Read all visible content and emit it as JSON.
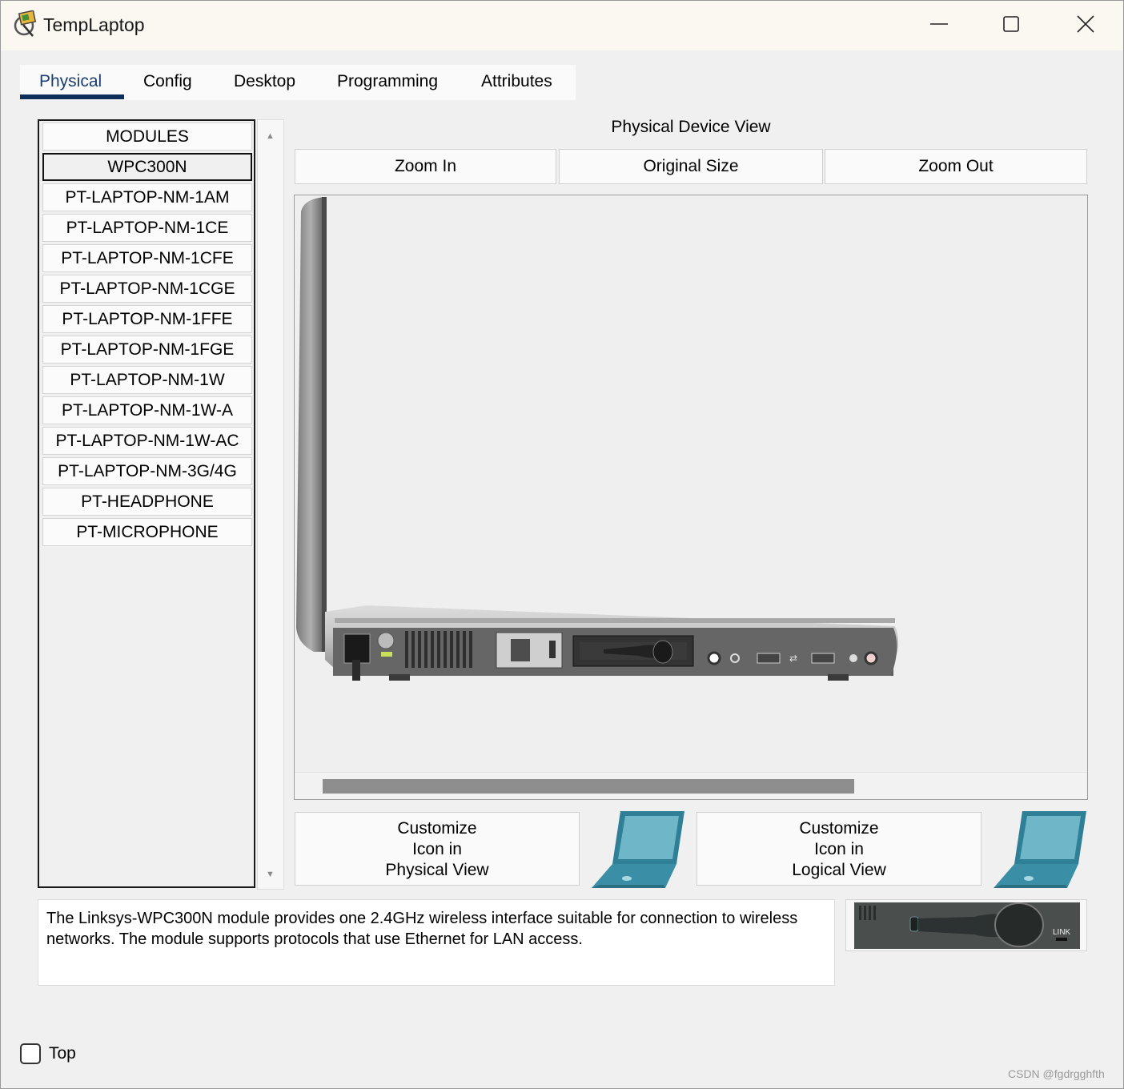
{
  "window": {
    "title": "TempLaptop"
  },
  "tabs": [
    {
      "label": "Physical",
      "active": true
    },
    {
      "label": "Config"
    },
    {
      "label": "Desktop"
    },
    {
      "label": "Programming"
    },
    {
      "label": "Attributes"
    }
  ],
  "modules": {
    "header": "MODULES",
    "selected": "WPC300N",
    "items": [
      "WPC300N",
      "PT-LAPTOP-NM-1AM",
      "PT-LAPTOP-NM-1CE",
      "PT-LAPTOP-NM-1CFE",
      "PT-LAPTOP-NM-1CGE",
      "PT-LAPTOP-NM-1FFE",
      "PT-LAPTOP-NM-1FGE",
      "PT-LAPTOP-NM-1W",
      "PT-LAPTOP-NM-1W-A",
      "PT-LAPTOP-NM-1W-AC",
      "PT-LAPTOP-NM-3G/4G",
      "PT-HEADPHONE",
      "PT-MICROPHONE"
    ]
  },
  "physical_view": {
    "title": "Physical Device View",
    "zoom_in": "Zoom In",
    "original_size": "Original Size",
    "zoom_out": "Zoom Out"
  },
  "customize": {
    "physical": {
      "line1": "Customize",
      "line2": "Icon in",
      "line3": "Physical View"
    },
    "logical": {
      "line1": "Customize",
      "line2": "Icon in",
      "line3": "Logical View"
    }
  },
  "description": "The Linksys-WPC300N module provides one 2.4GHz wireless interface suitable for connection to wireless networks. The module supports protocols that use Ethernet for LAN access.",
  "module_image_label": "LINK",
  "bottom": {
    "top_label": "Top",
    "top_checked": false
  },
  "watermark": "CSDN @fgdrgghfth",
  "colors": {
    "active_tab": "#0e2f5a",
    "icon_teal": "#3a8fa6"
  },
  "icons": [
    "app-icon",
    "minimize-icon",
    "maximize-icon",
    "close-icon",
    "laptop-icon"
  ]
}
